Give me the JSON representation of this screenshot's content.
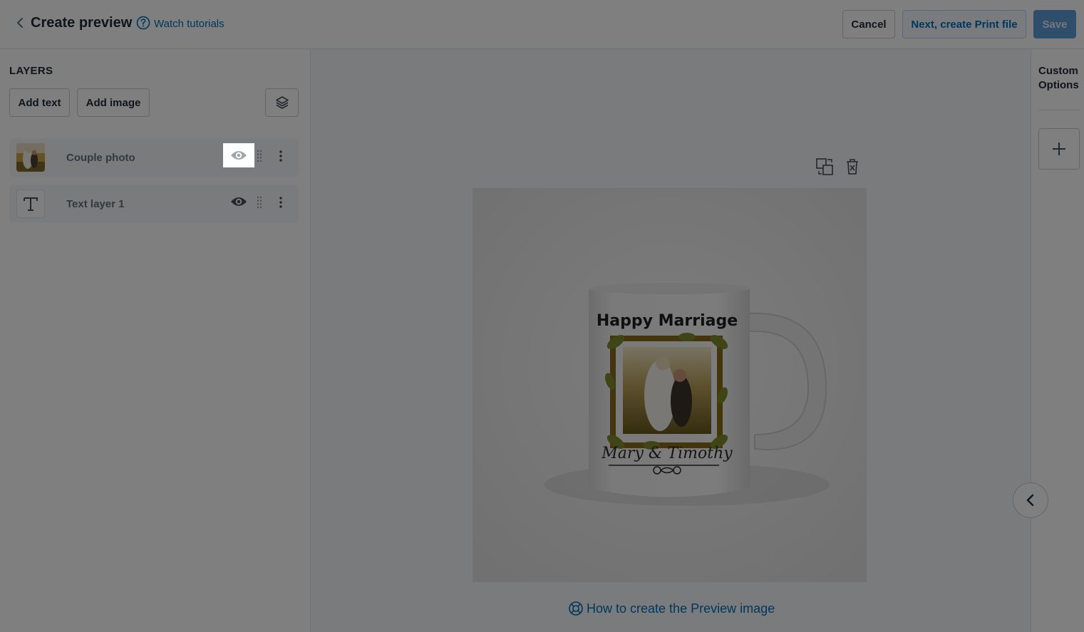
{
  "header": {
    "title": "Create preview",
    "tutorial_link": "Watch tutorials",
    "cancel_label": "Cancel",
    "next_label": "Next, create Print file",
    "save_label": "Save"
  },
  "layers": {
    "title": "LAYERS",
    "add_text_label": "Add text",
    "add_image_label": "Add image",
    "items": [
      {
        "name": "Couple photo",
        "type": "image",
        "visible": true
      },
      {
        "name": "Text layer 1",
        "type": "text",
        "visible": true
      }
    ]
  },
  "canvas": {
    "mug_text_top": "Happy Marriage",
    "mug_text_bottom": "Mary & Timothy",
    "help_link": "How to create the Preview image"
  },
  "right_panel": {
    "custom_options_label": "Custom Options"
  },
  "colors": {
    "accent": "#006fbb",
    "save_bg": "#5c9cd6",
    "overlay": "rgba(0,0,0,0.5)"
  }
}
